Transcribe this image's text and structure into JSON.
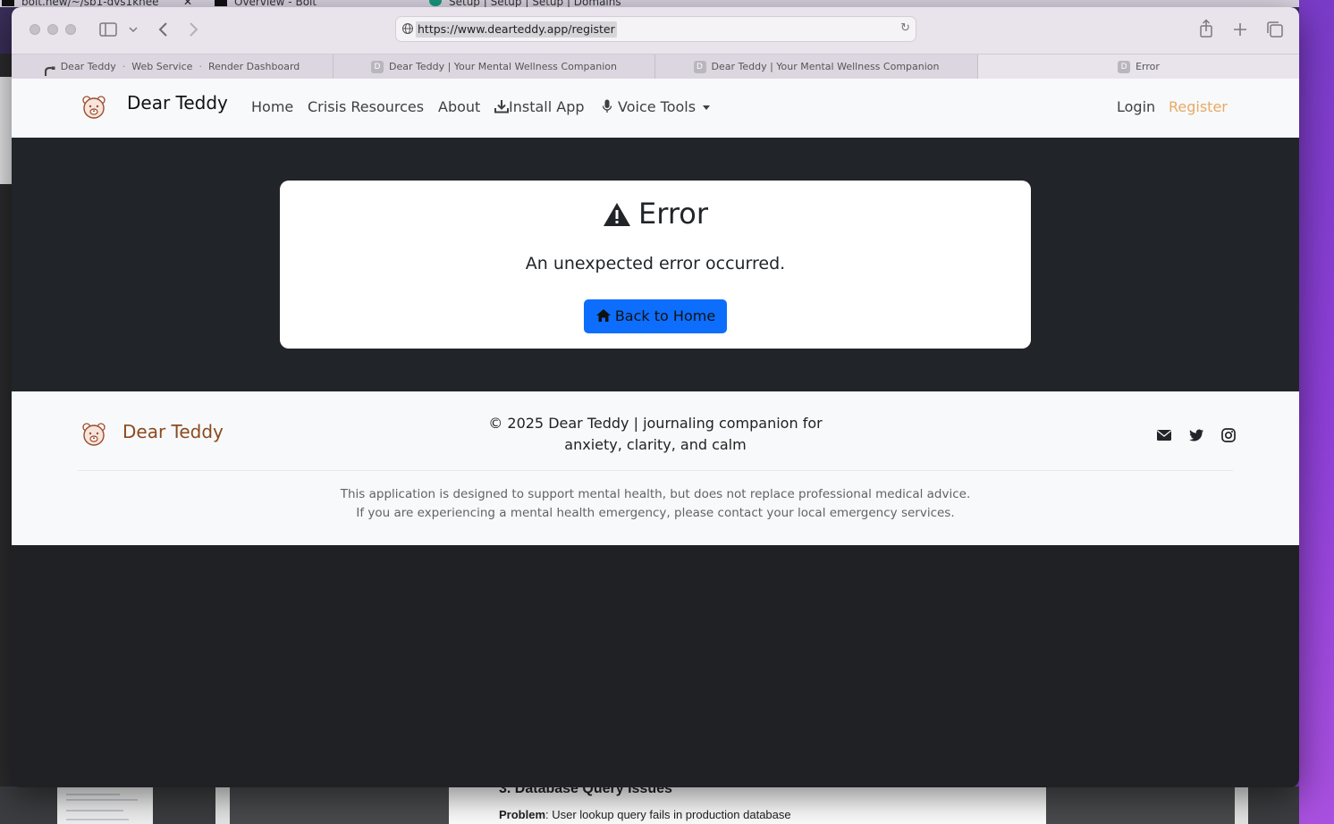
{
  "background": {
    "tabs": [
      "bolt.new/~/sb1-dvs1knee",
      "Overview - Bolt",
      "Setup | Setup | Setup | Domains"
    ],
    "doc_heading": "3. Database Query Issues",
    "doc_problem_label": "Problem",
    "doc_problem_text": ": User lookup query fails in production database"
  },
  "browser": {
    "url": "https://www.dearteddy.app/register",
    "tabs": [
      {
        "parts": [
          "Dear Teddy",
          "Web Service",
          "Render Dashboard"
        ]
      },
      {
        "favicon": "D",
        "title": "Dear Teddy | Your Mental Wellness Companion"
      },
      {
        "favicon": "D",
        "title": "Dear Teddy | Your Mental Wellness Companion"
      },
      {
        "favicon": "D",
        "title": "Error"
      }
    ]
  },
  "navbar": {
    "brand": "Dear Teddy",
    "links": {
      "home": "Home",
      "crisis": "Crisis Resources",
      "about": "About",
      "install": "Install App",
      "voice": "Voice Tools"
    },
    "login": "Login",
    "register": "Register"
  },
  "error": {
    "title": "Error",
    "message": "An unexpected error occurred.",
    "button": "Back to Home"
  },
  "footer": {
    "brand": "Dear Teddy",
    "copyright_line1": "© 2025 Dear Teddy | journaling companion for",
    "copyright_line2": "anxiety, clarity, and calm",
    "disclaimer_line1": "This application is designed to support mental health, but does not replace professional medical advice.",
    "disclaimer_line2": "If you are experiencing a mental health emergency, please contact your local emergency services.",
    "social": [
      "envelope-icon",
      "twitter-icon",
      "instagram-icon"
    ]
  },
  "colors": {
    "primary": "#0d6efd",
    "register": "#e8a965",
    "footer_brand": "#8b4a1f",
    "dark_bg": "#212529"
  }
}
